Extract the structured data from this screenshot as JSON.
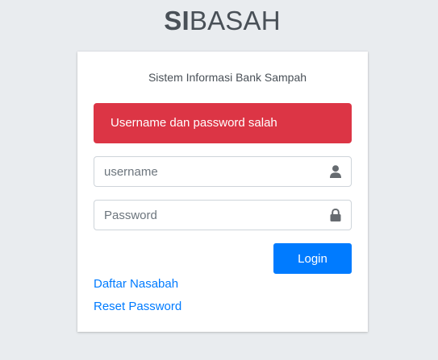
{
  "brand": {
    "bold": "SI",
    "light": "BASAH"
  },
  "login_box": {
    "subtitle": "Sistem Informasi Bank Sampah",
    "error_message": "Username dan password salah",
    "username": {
      "placeholder": "username",
      "value": ""
    },
    "password": {
      "placeholder": "Password",
      "value": ""
    },
    "login_label": "Login",
    "register_link": "Daftar Nasabah",
    "reset_link": "Reset Password"
  },
  "icons": {
    "username": "user-icon",
    "password": "lock-icon"
  },
  "colors": {
    "background": "#e9ecef",
    "error": "#dc3545",
    "primary": "#007bff",
    "icon": "#666b70"
  }
}
